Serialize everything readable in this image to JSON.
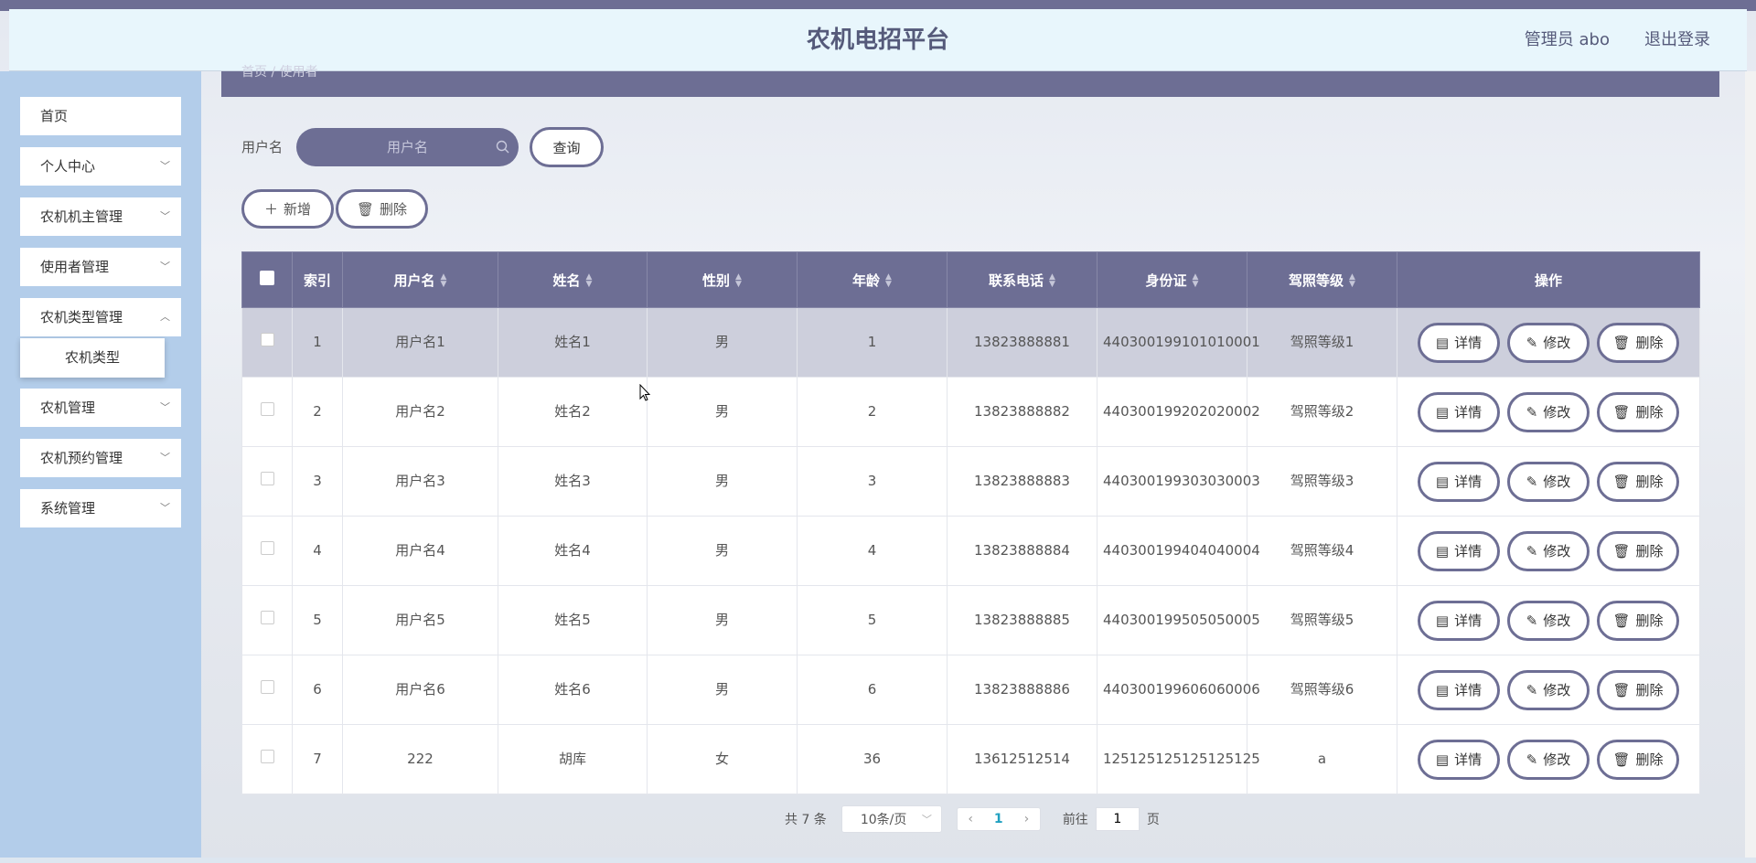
{
  "header": {
    "title": "农机电招平台",
    "admin": "管理员 abo",
    "logout": "退出登录"
  },
  "breadcrumb": "首页 / 使用者",
  "sidebar": {
    "items": [
      {
        "label": "首页",
        "chevron": false
      },
      {
        "label": "个人中心",
        "chevron": true
      },
      {
        "label": "农机机主管理",
        "chevron": true
      },
      {
        "label": "使用者管理",
        "chevron": true
      },
      {
        "label": "农机类型管理",
        "chevron": true
      },
      {
        "label": "农机管理",
        "chevron": true
      },
      {
        "label": "农机预约管理",
        "chevron": true
      },
      {
        "label": "系统管理",
        "chevron": true
      }
    ],
    "submenu": {
      "label": "农机类型"
    }
  },
  "search": {
    "label": "用户名",
    "placeholder": "用户名",
    "button": "查询"
  },
  "toolbar": {
    "add": "新增",
    "delete": "删除"
  },
  "table": {
    "columns": [
      "索引",
      "用户名",
      "姓名",
      "性别",
      "年龄",
      "联系电话",
      "身份证",
      "驾照等级",
      "操作"
    ],
    "rows": [
      [
        "1",
        "用户名1",
        "姓名1",
        "男",
        "1",
        "13823888881",
        "440300199101010001",
        "驾照等级1"
      ],
      [
        "2",
        "用户名2",
        "姓名2",
        "男",
        "2",
        "13823888882",
        "440300199202020002",
        "驾照等级2"
      ],
      [
        "3",
        "用户名3",
        "姓名3",
        "男",
        "3",
        "13823888883",
        "440300199303030003",
        "驾照等级3"
      ],
      [
        "4",
        "用户名4",
        "姓名4",
        "男",
        "4",
        "13823888884",
        "440300199404040004",
        "驾照等级4"
      ],
      [
        "5",
        "用户名5",
        "姓名5",
        "男",
        "5",
        "13823888885",
        "440300199505050005",
        "驾照等级5"
      ],
      [
        "6",
        "用户名6",
        "姓名6",
        "男",
        "6",
        "13823888886",
        "440300199606060006",
        "驾照等级6"
      ],
      [
        "7",
        "222",
        "胡库",
        "女",
        "36",
        "13612512514",
        "125125125125125125",
        "a"
      ]
    ],
    "actions": {
      "detail": "详情",
      "edit": "修改",
      "delete": "删除"
    }
  },
  "pagination": {
    "total": "共 7 条",
    "page_size": "10条/页",
    "current_page": "1",
    "goto_prefix": "前往",
    "goto_value": "1",
    "goto_suffix": "页"
  },
  "colors": {
    "accent": "#6d6e94",
    "sidebar": "#b3cdea",
    "header": "#e8f6fc"
  }
}
